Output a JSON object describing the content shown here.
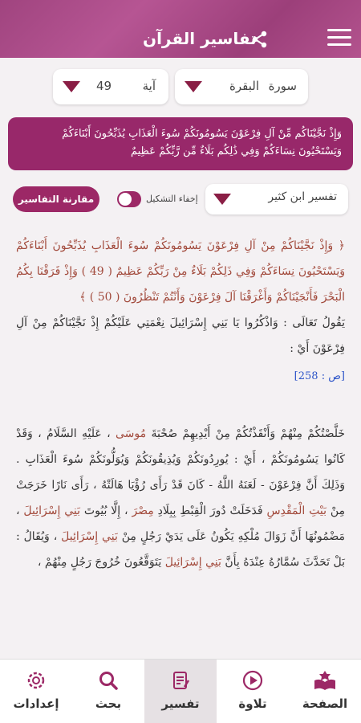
{
  "header": {
    "title": "تفاسير القرآن"
  },
  "selectors": {
    "surah_label": "سورة",
    "surah_value": "البقرة",
    "ayah_label": "آية",
    "ayah_value": "49"
  },
  "verse_box": "وَإِذْ نَجَّيْنَاكُم مِّنْ آلِ فِرْعَوْنَ يَسُومُونَكُمْ سُوءَ الْعَذَابِ يُذَبِّحُونَ أَبْنَاءَكُمْ وَيَسْتَحْيُونَ نِسَاءَكُمْ وَفِي ذَٰلِكُم بَلَاءٌ مِّن رَّبِّكُمْ عَظِيمٌ",
  "tafsir_controls": {
    "tafsir_name": "تفسير ابن كثير",
    "toggle_label": "إخفاء التشكيل",
    "compare_button": "مقارنة التفاسير"
  },
  "content": {
    "quran_text": "﴿ وَإِذْ نَجَّيْنَاكُمْ مِنْ آلِ فِرْعَوْنَ يَسُومُونَكُمْ سُوءَ الْعَذَابِ يُذَبِّحُونَ أَبْنَاءَكُمْ وَيَسْتَحْيُونَ نِسَاءَكُمْ وَفِي ذَلِكُمْ بَلَاءٌ مِنْ رَبِّكُمْ عَظِيمٌ ( 49 ) وَإِذْ فَرَقْنَا بِكُمُ الْبَحْرَ فَأَنْجَيْنَاكُمْ وَأَغْرَقْنَا آلَ فِرْعَوْنَ وَأَنْتُمْ تَنْظُرُونَ ( 50 ) ﴾",
    "intro_text": "يَقُولُ تَعَالَى : وَاذْكُرُوا يَا بَنِي إِسْرَائِيلَ نِعْمَتِي عَلَيْكُمْ إِذْ نَجَّيْنَاكُمْ مِنْ آلِ فِرْعَوْنَ أَيْ :",
    "page_ref": "[ص : 258]",
    "body_parts": [
      "خَلَّصْتُكُمْ مِنْهُمْ وَأَنْقَذْتُكُمْ مِنْ أَيْدِيهِمْ صُحْبَةَ ",
      "مُوسَى",
      " ، عَلَيْهِ السَّلَامُ ، وَقَدْ كَانُوا يَسُومُونَكُمْ ، أَيْ : يُورِدُونَكُمْ وَيُذِيقُونَكُمْ وَيُوَلُّونَكُمْ سُوءَ الْعَذَابِ . وَذَلِكَ أَنَّ فِرْعَوْنَ - لَعَنَهُ اللَّهُ - كَانَ قَدْ رَأَى رُؤْيَا هَالَتْهُ ، رَأَى نَارًا خَرَجَتْ مِنْ ",
      "بَيْتِ الْمَقْدِسِ",
      " فَدَخَلَتْ دُورَ الْقِبْطِ بِبِلَادِ ",
      "مِصْرَ",
      " ، إِلَّا بُيُوتَ ",
      "بَنِي إِسْرَائِيلَ",
      " ، مَضْمُونُهَا أَنَّ زَوَالَ مُلْكِهِ يَكُونُ عَلَى يَدَيْ رَجُلٍ مِنْ ",
      "بَنِي إِسْرَائِيلَ",
      " ، وَيُقَالُ : بَلْ تَحَدَّثَ سُمَّارُهُ عِنْدَهُ بِأَنَّ ",
      "بَنِي إِسْرَائِيلَ",
      " يَتَوَقَّعُونَ خُرُوجَ رَجُلٍ مِنْهُمْ ،"
    ]
  },
  "bottom_nav": [
    {
      "label": "الصفحة",
      "icon": "quran-book-icon"
    },
    {
      "label": "تلاوة",
      "icon": "play-icon"
    },
    {
      "label": "تفسير",
      "icon": "tafsir-notes-icon"
    },
    {
      "label": "بحث",
      "icon": "search-icon"
    },
    {
      "label": "إعدادات",
      "icon": "gear-icon"
    }
  ],
  "colors": {
    "primary": "#9c2866",
    "quran_text": "#a24a3c",
    "link": "#2c54c8"
  }
}
